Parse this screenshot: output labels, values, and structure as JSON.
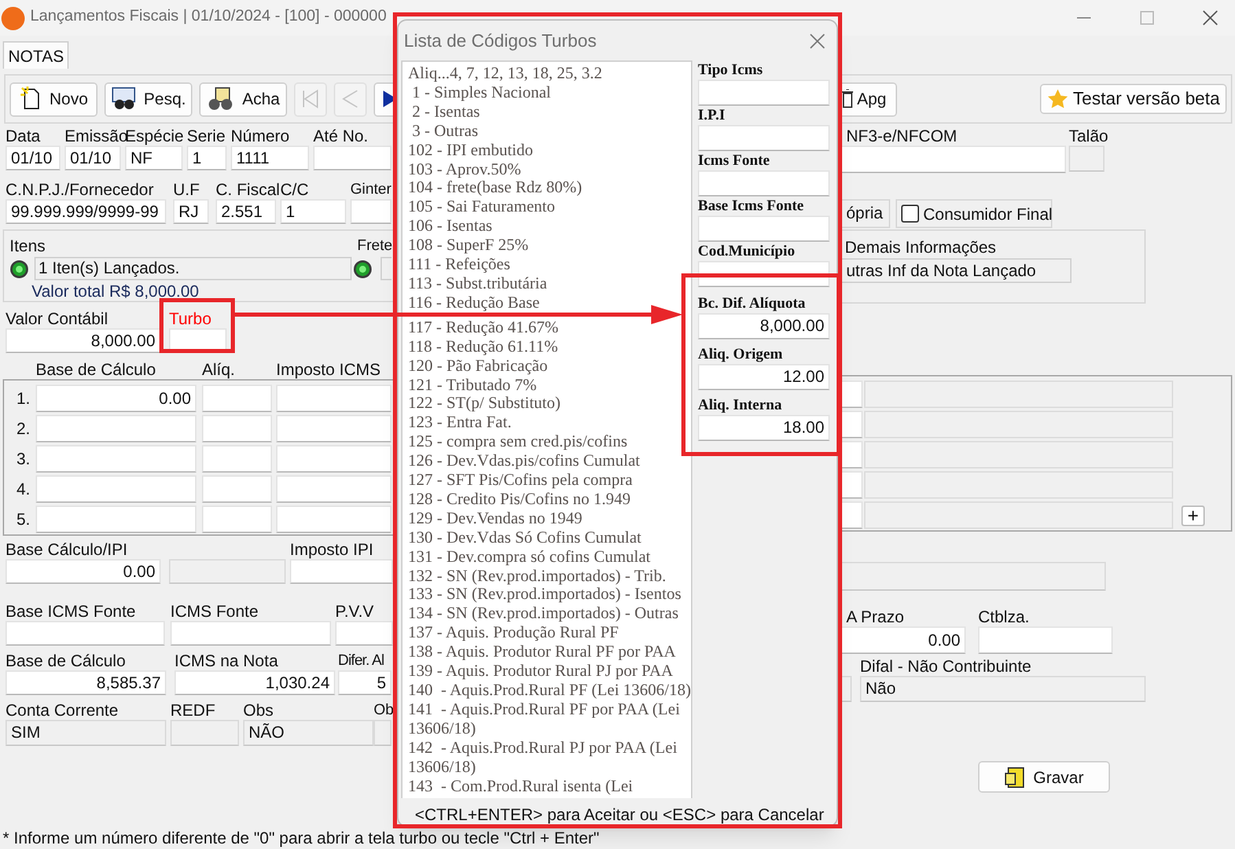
{
  "window": {
    "title": "Lançamentos Fiscais | 01/10/2024 - [100] - 000000"
  },
  "tabs": [
    {
      "label": "NOTAS",
      "selected": true
    }
  ],
  "toolbar": {
    "buttons": [
      {
        "kind": "new",
        "label": "Novo"
      },
      {
        "kind": "search",
        "label": "Pesq."
      },
      {
        "kind": "find",
        "label": "Acha"
      }
    ],
    "nav": [
      {
        "kind": "first",
        "disabled": true
      },
      {
        "kind": "prev",
        "disabled": true
      },
      {
        "kind": "next",
        "disabled": false
      }
    ],
    "delete_button": "Apg",
    "beta_button": "Testar versão beta"
  },
  "header_rows": [
    [
      {
        "label": "Data",
        "value": "01/10",
        "readonly": false
      },
      {
        "label": "Emissão",
        "value": "01/10",
        "readonly": false
      },
      {
        "label": "Espécie",
        "value": "NF",
        "readonly": false
      },
      {
        "label": "Serie",
        "value": "1",
        "readonly": false
      },
      {
        "label": "Número",
        "value": "1111",
        "readonly": false
      },
      {
        "label": "Até No.",
        "readonly": false
      }
    ],
    [
      {
        "label": "C.N.P.J./Fornecedor",
        "value": "99.999.999/9999-99",
        "readonly": false
      },
      {
        "label": "U.F",
        "value": "RJ",
        "readonly": false
      },
      {
        "label": "C. Fiscal",
        "value": "2.551",
        "readonly": false
      },
      {
        "label": "C/C",
        "value": "1",
        "readonly": false
      },
      {
        "label": "Ginter",
        "readonly": false
      }
    ]
  ],
  "items_panel": {
    "label": "Itens",
    "value": "1 Iten(s) Lançados.",
    "total": "Valor total R$ 8,000.00",
    "freight_label": "Frete"
  },
  "value_row": [
    {
      "label": "Valor Contábil",
      "value": "8,000.00",
      "readonly": false,
      "highlight": false
    },
    {
      "label": "Turbo",
      "readonly": false,
      "highlight": true
    }
  ],
  "tax_grid": {
    "columns": [
      "Base de Cálculo",
      "Alíq.",
      "Imposto ICMS"
    ],
    "rows": [
      {
        "number": "1.",
        "base": "0.00"
      },
      {
        "number": "2."
      },
      {
        "number": "3."
      },
      {
        "number": "4."
      },
      {
        "number": "5."
      }
    ],
    "add_button": "+"
  },
  "lower_rows": [
    [
      {
        "label": "Base Cálculo/IPI",
        "value": "0.00",
        "readonly": false
      },
      {
        "readonly": true
      },
      {
        "label": "Imposto IPI",
        "readonly": false
      }
    ],
    [
      {
        "label": "Base ICMS Fonte",
        "readonly": false
      },
      {
        "label": "ICMS Fonte",
        "readonly": false
      },
      {
        "label": "P.V.V",
        "readonly": false
      }
    ],
    [
      {
        "label": "Base de Cálculo",
        "value": "8,585.37",
        "readonly": false
      },
      {
        "label": "ICMS na Nota",
        "value": "1,030.24",
        "readonly": false
      },
      {
        "label": "Difer. Al",
        "value": "5",
        "readonly": false
      }
    ],
    [
      {
        "label": "Conta Corrente",
        "value": "SIM",
        "readonly": true
      },
      {
        "label": "REDF",
        "readonly": true
      },
      {
        "label": "Obs",
        "value": "NÃO",
        "readonly": true
      },
      {
        "label": "Ob",
        "readonly": true
      }
    ]
  ],
  "right_panel": {
    "nf": {
      "label": "NF3-e/NFCOM",
      "readonly": false
    },
    "talao": {
      "label": "Talão",
      "readonly": true
    },
    "own": "ópria",
    "final_consumer": {
      "label": "Consumidor Final",
      "checked": false
    },
    "other_info": {
      "label": "Demais Informações",
      "value": "utras Inf da Nota Lançado"
    },
    "rows": [
      [
        {
          "readonly": true
        }
      ],
      [
        {
          "label": "A Prazo",
          "value": "0.00",
          "readonly": false
        },
        {
          "label": "Ctblza.",
          "readonly": false
        }
      ],
      [
        {
          "readonly": true
        },
        {
          "label": "Difal - Não Contribuinte",
          "value": "Não",
          "readonly": true
        }
      ]
    ],
    "save_button": "Gravar"
  },
  "dialog": {
    "title": "Lista de Códigos Turbos",
    "list": [
      "Aliq...4, 7, 12, 13, 18, 25, 3.2",
      " 1 - Simples Nacional",
      " 2 - Isentas",
      " 3 - Outras",
      "102 - IPI embutido",
      "103 - Aprov.50%",
      "104 - frete(base Rdz 80%)",
      "105 - Sai Faturamento",
      "106 - Isentas",
      "108 - SuperF 25%",
      "111 - Refeições",
      "113 - Subst.tributária",
      "116 - Redução Base",
      "117 - Redução 41.67%",
      "118 - Redução 61.11%",
      "120 - Pão Fabricação",
      "121 - Tributado 7%",
      "122 - ST(p/ Substituto)",
      "123 - Entra Fat.",
      "125 - compra sem cred.pis/cofins",
      "126 - Dev.Vdas.pis/cofins Cumulat",
      "127 - SFT Pis/Cofins pela compra",
      "128 - Credito Pis/Cofins no 1.949",
      "129 - Dev.Vendas no 1949",
      "130 - Dev.Vdas Só Cofins Cumulat",
      "131 - Dev.compra só cofins Cumulat",
      "132 - SN (Rev.prod.importados) - Trib.",
      "133 - SN (Rev.prod.importados) - Isentos",
      "134 - SN (Rev.prod.importados) - Outras",
      "137 - Aquis. Produção Rural PF",
      "138 - Aquis. Produtor Rural PF por PAA",
      "139 - Aquis. Produtor Rural PJ por PAA",
      "140  - Aquis.Prod.Rural PF (Lei 13606/18)",
      "141  - Aquis.Prod.Rural PF por PAA (Lei 13606/18)",
      "142  - Aquis.Prod.Rural PJ por PAA (Lei 13606/18)",
      "143  - Com.Prod.Rural isenta (Lei"
    ],
    "fields": [
      {
        "label": "Tipo Icms",
        "readonly": false
      },
      {
        "label": "I.P.I",
        "readonly": false
      },
      {
        "label": "Icms Fonte",
        "readonly": false
      },
      {
        "label": "Base Icms Fonte",
        "readonly": false
      },
      {
        "label": "Cod.Município",
        "readonly": false
      },
      {
        "label": "Bc. Dif. Alíquota",
        "value": "8,000.00",
        "readonly": false
      },
      {
        "label": "Aliq. Origem",
        "value": "12.00",
        "readonly": false
      },
      {
        "label": "Aliq. Interna",
        "value": "18.00",
        "readonly": false
      }
    ],
    "hint": "<CTRL+ENTER> para Aceitar ou <ESC> para Cancelar"
  },
  "status_bar": "* Informe um número diferente de \"0\" para abrir a tela turbo ou tecle \"Ctrl + Enter\""
}
